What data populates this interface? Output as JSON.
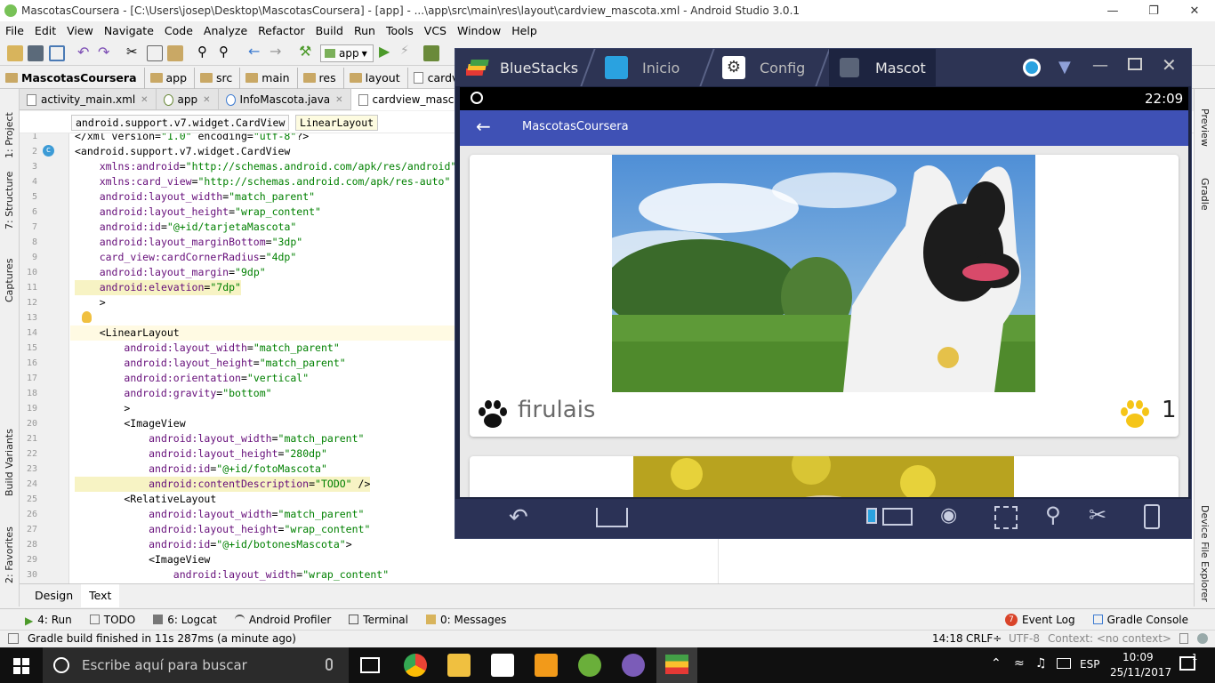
{
  "window": {
    "title": "MascotasCoursera - [C:\\Users\\josep\\Desktop\\MascotasCoursera] - [app] - ...\\app\\src\\main\\res\\layout\\cardview_mascota.xml - Android Studio 3.0.1"
  },
  "menu": [
    "File",
    "Edit",
    "View",
    "Navigate",
    "Code",
    "Analyze",
    "Refactor",
    "Build",
    "Run",
    "Tools",
    "VCS",
    "Window",
    "Help"
  ],
  "toolbar": {
    "config": "app"
  },
  "breadcrumb": [
    "MascotasCoursera",
    "app",
    "src",
    "main",
    "res",
    "layout",
    "cardview_masc"
  ],
  "tabs": [
    {
      "label": "activity_main.xml"
    },
    {
      "label": "app"
    },
    {
      "label": "InfoMascota.java"
    },
    {
      "label": "cardview_mascota.xm"
    }
  ],
  "editor_crumbs": [
    "android.support.v7.widget.CardView",
    "LinearLayout"
  ],
  "code_lines": [
    {
      "n": "1",
      "t": "</xml version=\"1.0\" encoding=\"utf-8\"?>"
    },
    {
      "n": "2",
      "t": "<android.support.v7.widget.CardView"
    },
    {
      "n": "3",
      "t": "    xmlns:android=\"http://schemas.android.com/apk/res/android\""
    },
    {
      "n": "4",
      "t": "    xmlns:card_view=\"http://schemas.android.com/apk/res-auto\""
    },
    {
      "n": "5",
      "t": "    android:layout_width=\"match_parent\""
    },
    {
      "n": "6",
      "t": "    android:layout_height=\"wrap_content\""
    },
    {
      "n": "7",
      "t": "    android:id=\"@+id/tarjetaMascota\""
    },
    {
      "n": "8",
      "t": "    android:layout_marginBottom=\"3dp\""
    },
    {
      "n": "9",
      "t": "    card_view:cardCornerRadius=\"4dp\""
    },
    {
      "n": "10",
      "t": "    android:layout_margin=\"9dp\""
    },
    {
      "n": "11",
      "t": "    android:elevation=\"7dp\""
    },
    {
      "n": "12",
      "t": "    >"
    },
    {
      "n": "13",
      "t": ""
    },
    {
      "n": "14",
      "t": "    <LinearLayout"
    },
    {
      "n": "15",
      "t": "        android:layout_width=\"match_parent\""
    },
    {
      "n": "16",
      "t": "        android:layout_height=\"match_parent\""
    },
    {
      "n": "17",
      "t": "        android:orientation=\"vertical\""
    },
    {
      "n": "18",
      "t": "        android:gravity=\"bottom\""
    },
    {
      "n": "19",
      "t": "        >"
    },
    {
      "n": "20",
      "t": "        <ImageView"
    },
    {
      "n": "21",
      "t": "            android:layout_width=\"match_parent\""
    },
    {
      "n": "22",
      "t": "            android:layout_height=\"280dp\""
    },
    {
      "n": "23",
      "t": "            android:id=\"@+id/fotoMascota\""
    },
    {
      "n": "24",
      "t": "            android:contentDescription=\"TODO\" />"
    },
    {
      "n": "25",
      "t": "        <RelativeLayout"
    },
    {
      "n": "26",
      "t": "            android:layout_width=\"match_parent\""
    },
    {
      "n": "27",
      "t": "            android:layout_height=\"wrap_content\""
    },
    {
      "n": "28",
      "t": "            android:id=\"@+id/botonesMascota\">"
    },
    {
      "n": "29",
      "t": "            <ImageView"
    },
    {
      "n": "30",
      "t": "                android:layout_width=\"wrap_content\""
    }
  ],
  "design_tabs": [
    "Design",
    "Text"
  ],
  "tool_windows": [
    {
      "label": "4: Run"
    },
    {
      "label": "TODO"
    },
    {
      "label": "6: Logcat"
    },
    {
      "label": "Android Profiler"
    },
    {
      "label": "Terminal"
    },
    {
      "label": "0: Messages"
    }
  ],
  "tool_windows_right": [
    {
      "label": "Event Log",
      "badge": "7"
    },
    {
      "label": "Gradle Console"
    }
  ],
  "left_strip": [
    "1: Project",
    "7: Structure",
    "Captures",
    "Build Variants",
    "2: Favorites"
  ],
  "right_strip": [
    "Preview",
    "Gradle",
    "Device File Explorer"
  ],
  "status": {
    "message": "Gradle build finished in 11s 287ms (a minute ago)",
    "position": "14:18",
    "line_sep": "CRLF÷",
    "encoding": "UTF-8",
    "context": "Context: <no context>"
  },
  "bluestacks": {
    "brand": "BlueStacks",
    "tabs": [
      "Inicio",
      "Config",
      "Mascot"
    ],
    "time": "22:09",
    "app_title": "MascotasCoursera",
    "pet_name": "firulais",
    "likes": "1"
  },
  "taskbar": {
    "search_placeholder": "Escribe aquí para buscar",
    "lang": "ESP",
    "time": "10:09",
    "date": "25/11/2017",
    "notif_count": "1"
  },
  "colors": {
    "accent_app_bar": "#3f51b5",
    "bluestacks_frame": "#2d3454",
    "paw_yellow": "#f5c518"
  }
}
